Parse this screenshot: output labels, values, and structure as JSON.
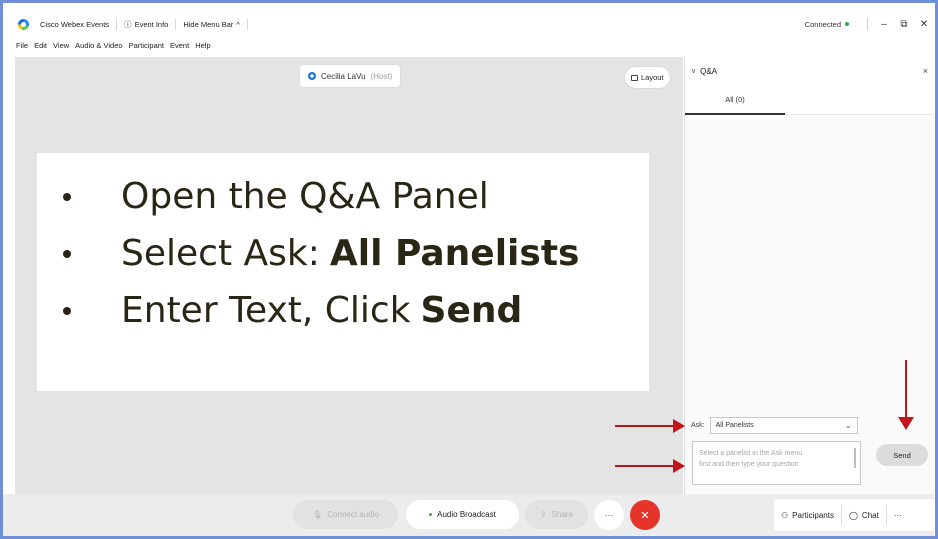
{
  "titlebar": {
    "app_name": "Cisco Webex Events",
    "event_info": "Event Info",
    "hide_menu_bar": "Hide Menu Bar",
    "status": "Connected",
    "minimize": "–",
    "restore": "⧉",
    "close": "✕"
  },
  "menubar": [
    "File",
    "Edit",
    "View",
    "Audio & Video",
    "Participant",
    "Event",
    "Help"
  ],
  "stage": {
    "host_name": "Cecilia LaVu",
    "host_role": "(Host)",
    "layout_label": "Layout"
  },
  "slide": {
    "bullets": [
      {
        "text": "Open the Q&A Panel",
        "bold": ""
      },
      {
        "text": "Select Ask:",
        "bold": "All Panelists"
      },
      {
        "text": "Enter Text, Click",
        "bold": "Send"
      }
    ]
  },
  "panel": {
    "title": "Q&A",
    "close": "×",
    "tab_all": "All (0)",
    "ask_label": "Ask:",
    "ask_value": "All Panelists",
    "question_placeholder_1": "Select a panelist in the Ask menu",
    "question_placeholder_2": "first and then type your question",
    "send_label": "Send"
  },
  "bottombar": {
    "connect_audio": "Connect audio",
    "audio_broadcast": "Audio Broadcast",
    "share": "Share",
    "more": "···",
    "end": "✕",
    "participants": "Participants",
    "chat": "Chat",
    "more_right": "···"
  },
  "colors": {
    "accent_border": "#6f8fd6",
    "end_button": "#e5352b",
    "annotation_arrow": "#c0161a",
    "connected_dot": "#2ea94b"
  }
}
